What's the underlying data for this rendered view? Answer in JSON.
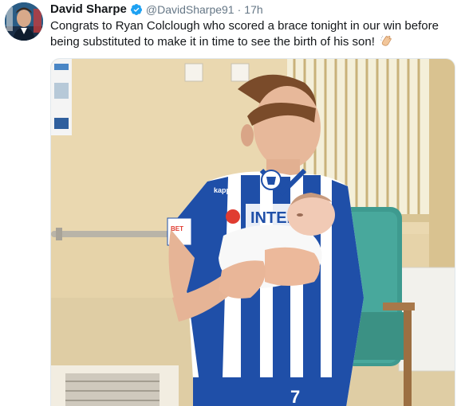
{
  "tweet": {
    "display_name": "David Sharpe",
    "handle": "@DavidSharpe91",
    "separator": "·",
    "time": "17h",
    "text": "Congrats to Ryan Colclough who scored a brace tonight in our win before being substituted to make it in time to see the birth of his son!",
    "verified": true,
    "emoji": "clapping-hands"
  },
  "media": {
    "description_icon": "photo",
    "shirt_sponsor": "INTER",
    "shirt_sleeve": "BET",
    "shirt_brand": "kappa",
    "shirt_number": "7"
  },
  "colors": {
    "name": "#14171a",
    "secondary": "#657786",
    "verified": "#1da1f2",
    "shirt_blue": "#1f4fa8",
    "chair_teal": "#3e9a8f"
  }
}
